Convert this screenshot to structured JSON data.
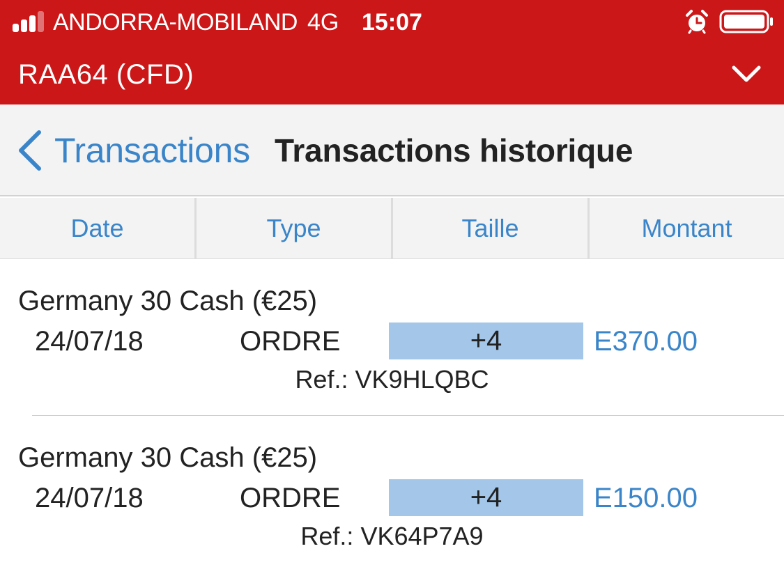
{
  "status_bar": {
    "carrier": "ANDORRA-MOBILAND",
    "network": "4G",
    "time": "15:07",
    "signal_bars_active": 3,
    "signal_bars_total": 4
  },
  "header": {
    "account_name": "RAA64 (CFD)"
  },
  "nav": {
    "back_label": "Transactions",
    "title": "Transactions historique"
  },
  "columns": [
    "Date",
    "Type",
    "Taille",
    "Montant"
  ],
  "transactions": [
    {
      "instrument": "Germany 30 Cash (€25)",
      "date": "24/07/18",
      "type": "ORDRE",
      "size": "+4",
      "amount": "E370.00",
      "ref_label": "Ref.:",
      "ref": "VK9HLQBC"
    },
    {
      "instrument": "Germany 30 Cash (€25)",
      "date": "24/07/18",
      "type": "ORDRE",
      "size": "+4",
      "amount": "E150.00",
      "ref_label": "Ref.:",
      "ref": "VK64P7A9"
    }
  ],
  "colors": {
    "brand_red": "#cc1719",
    "link_blue": "#3a85c9",
    "size_highlight": "#a3c6e9",
    "nav_background": "#f3f3f3"
  },
  "icons": {
    "signal": "cellular-signal-icon",
    "alarm": "alarm-clock-icon",
    "battery": "battery-icon",
    "account_toggle": "chevron-down-icon",
    "back": "chevron-left-icon"
  }
}
